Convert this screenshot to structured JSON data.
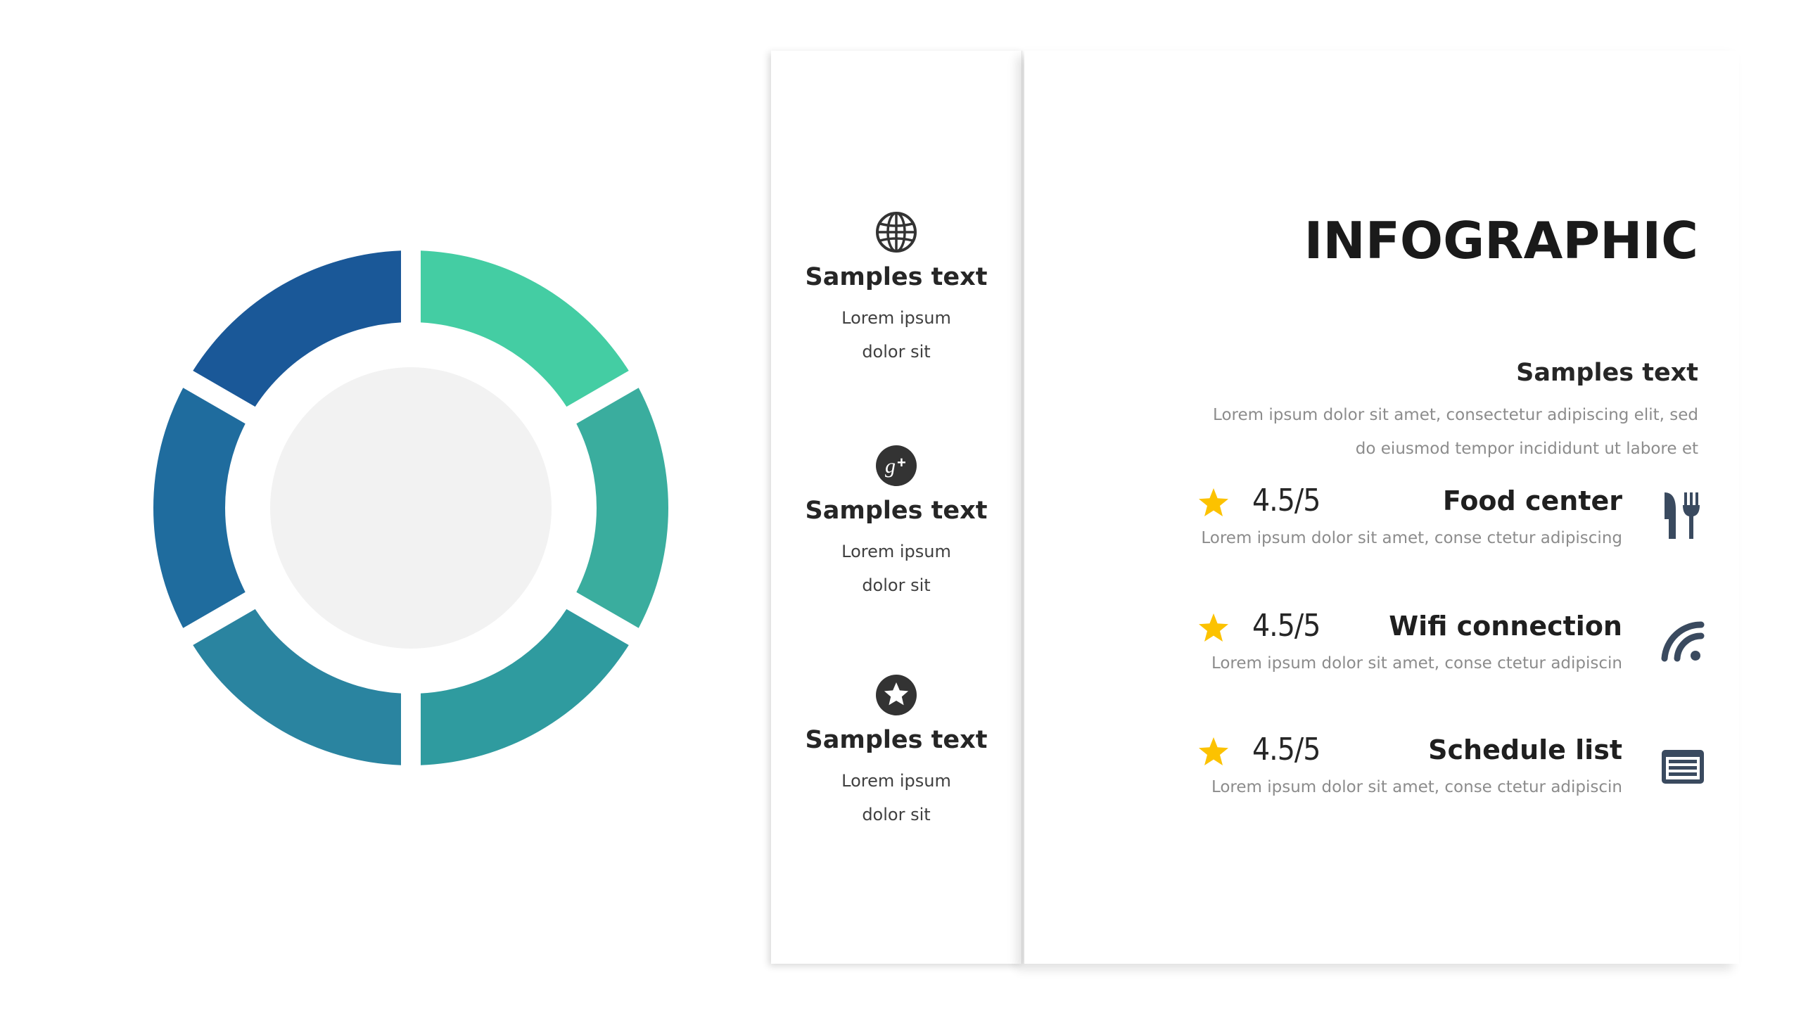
{
  "colors": {
    "segments": [
      "#44cda3",
      "#3aad9e",
      "#2f9b9f",
      "#2a84a0",
      "#1f6c9e",
      "#1a5898"
    ],
    "center": "#f2f2f2",
    "star": "#fcc200",
    "icon_dark": "#333333",
    "icon_slate": "#3a4a5f"
  },
  "ring_segments": [
    {
      "name": "segment-top-right"
    },
    {
      "name": "segment-right"
    },
    {
      "name": "segment-bottom-right"
    },
    {
      "name": "segment-bottom-left"
    },
    {
      "name": "segment-left"
    },
    {
      "name": "segment-top-left"
    }
  ],
  "sidebar": {
    "items": [
      {
        "icon": "globe-icon",
        "title": "Samples text",
        "line1": "Lorem ipsum",
        "line2": "dolor sit"
      },
      {
        "icon": "google-plus-icon",
        "title": "Samples text",
        "line1": "Lorem ipsum",
        "line2": "dolor sit"
      },
      {
        "icon": "star-circle-icon",
        "title": "Samples text",
        "line1": "Lorem ipsum",
        "line2": "dolor sit"
      }
    ]
  },
  "main": {
    "headline": "INFOGRAPHIC",
    "subhead": "Samples text",
    "paragraph": "Lorem ipsum dolor sit amet, consectetur adipiscing elit, sed do eiusmod tempor incididunt ut labore et",
    "features": [
      {
        "rating": "4.5/5",
        "title": "Food center",
        "desc": "Lorem ipsum dolor sit amet, conse ctetur adipiscing",
        "icon": "utensils-icon"
      },
      {
        "rating": "4.5/5",
        "title": "Wifi connection",
        "desc": "Lorem ipsum dolor sit amet, conse ctetur adipiscin",
        "icon": "wifi-icon"
      },
      {
        "rating": "4.5/5",
        "title": "Schedule  list",
        "desc": "Lorem ipsum dolor sit amet, conse ctetur adipiscin",
        "icon": "schedule-list-icon"
      }
    ]
  }
}
